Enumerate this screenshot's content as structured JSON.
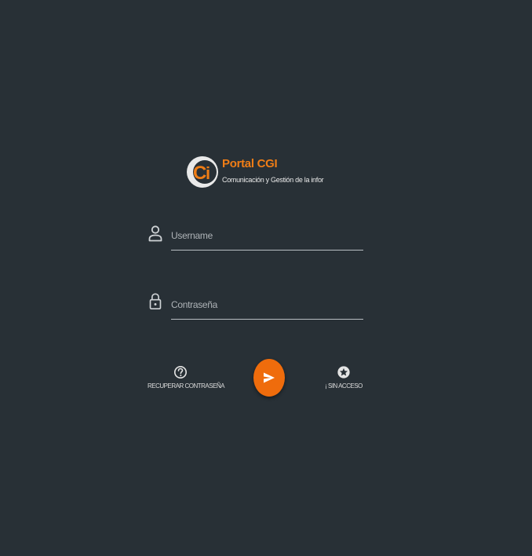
{
  "brand": {
    "title": "Portal CGI",
    "subtitle": "Comunicación y Gestión de la informació",
    "logo_letters": "CGi",
    "logo_icon": "cgi-logo-icon",
    "accent_color": "#ef7d16"
  },
  "login": {
    "username_placeholder": "Username",
    "username_icon": "person-icon",
    "password_placeholder": "Contraseña",
    "password_icon": "lock-icon",
    "submit_icon": "send-arrow-icon",
    "submit_color": "#ef6c0c"
  },
  "actions": {
    "recover_label": "RECUPERAR CONTRASEÑA",
    "recover_icon": "help-circle-icon",
    "noaccess_label": "¡ SIN ACCESO",
    "noaccess_icon": "star-circle-icon"
  },
  "theme": {
    "background": "#283036"
  }
}
